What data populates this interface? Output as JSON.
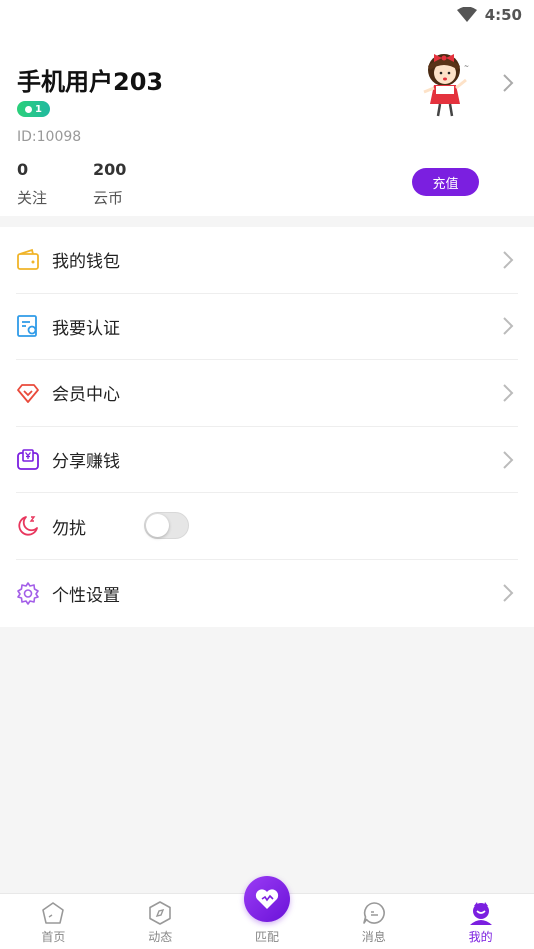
{
  "status_bar": {
    "time": "4:50"
  },
  "profile": {
    "username": "手机用户203",
    "level": "1",
    "user_id": "ID:10098",
    "stats": [
      {
        "value": "0",
        "label": "关注"
      },
      {
        "value": "200",
        "label": "云币"
      }
    ],
    "recharge_label": "充值"
  },
  "menu": {
    "items": [
      {
        "label": "我的钱包",
        "icon": "wallet-icon"
      },
      {
        "label": "我要认证",
        "icon": "certificate-icon"
      },
      {
        "label": "会员中心",
        "icon": "diamond-icon"
      },
      {
        "label": "分享赚钱",
        "icon": "yuan-bag-icon"
      },
      {
        "label": "勿扰",
        "icon": "moon-icon",
        "toggle": false
      },
      {
        "label": "个性设置",
        "icon": "gear-icon"
      }
    ]
  },
  "tabs": [
    {
      "label": "首页",
      "icon": "home-icon"
    },
    {
      "label": "动态",
      "icon": "compass-icon"
    },
    {
      "label": "匹配",
      "icon": "heart-icon"
    },
    {
      "label": "消息",
      "icon": "message-icon"
    },
    {
      "label": "我的",
      "icon": "profile-icon",
      "active": true
    }
  ],
  "colors": {
    "accent": "#7b1fe0",
    "level_badge": "#2bd07a"
  }
}
